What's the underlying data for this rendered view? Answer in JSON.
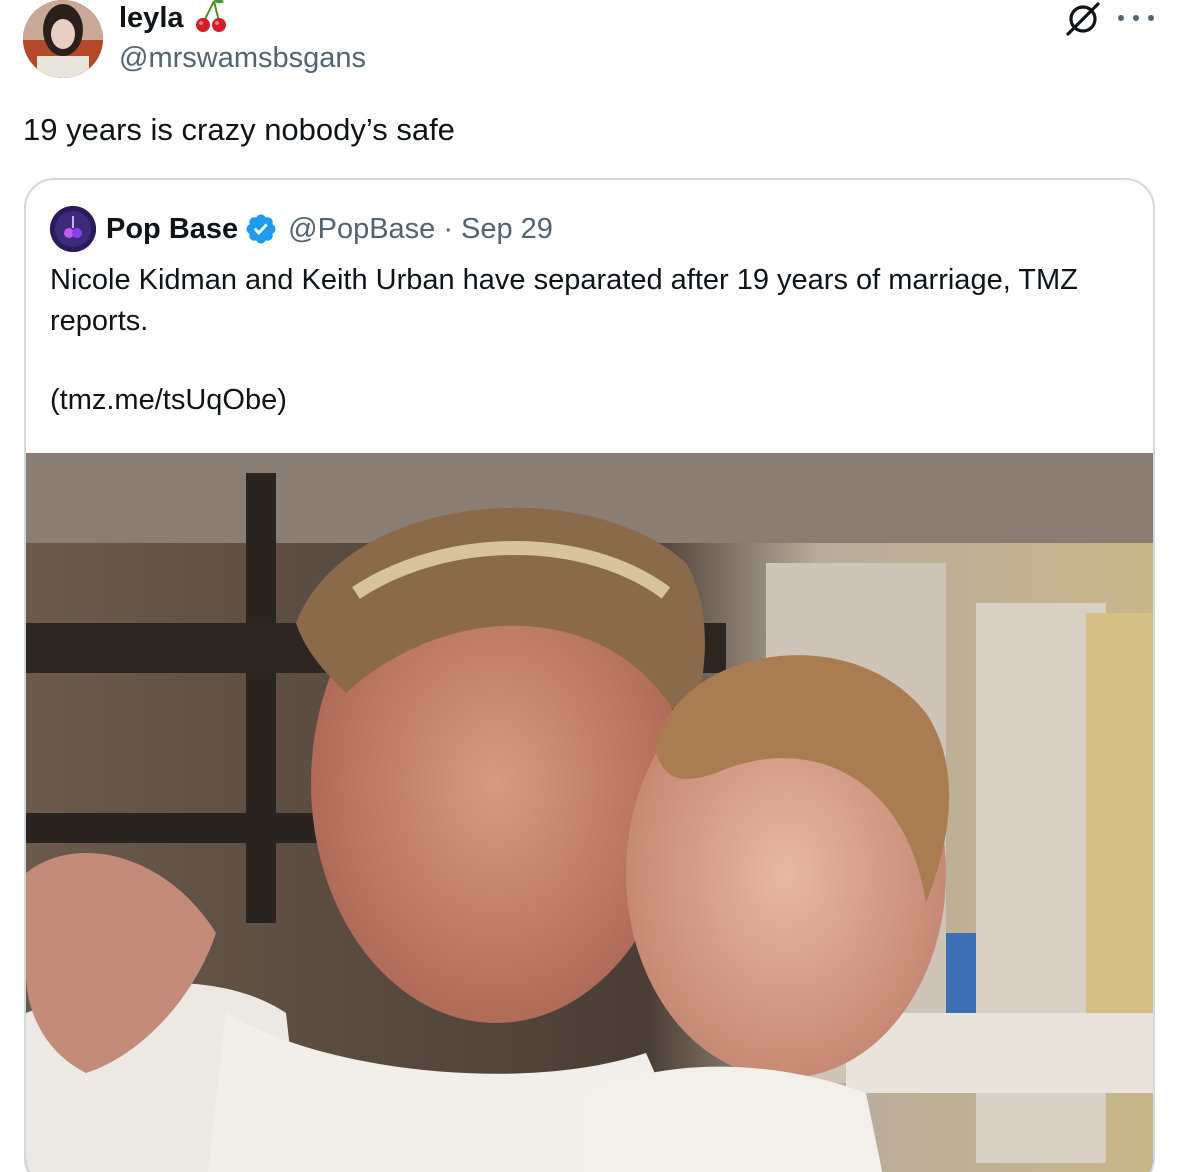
{
  "author": {
    "name": "leyla",
    "handle": "@mrswamsbsgans",
    "avatar_icon": "user-avatar",
    "badge_icon": "cherry-icon"
  },
  "tweet": {
    "text": "19 years is crazy nobody’s safe"
  },
  "actions": {
    "grok_icon": "grok-icon",
    "more_icon": "more-icon"
  },
  "quoted_tweet": {
    "name": "Pop Base",
    "verified": true,
    "handle": "@PopBase",
    "separator": "·",
    "date": "Sep 29",
    "text": "Nicole Kidman and Keith Urban have separated after 19 years of marriage, TMZ reports.",
    "link": "(tmz.me/tsUqObe)",
    "verified_color": "#1d9bf0"
  },
  "colors": {
    "text_primary": "#0f1419",
    "text_secondary": "#536471",
    "border": "#cfd9de"
  }
}
